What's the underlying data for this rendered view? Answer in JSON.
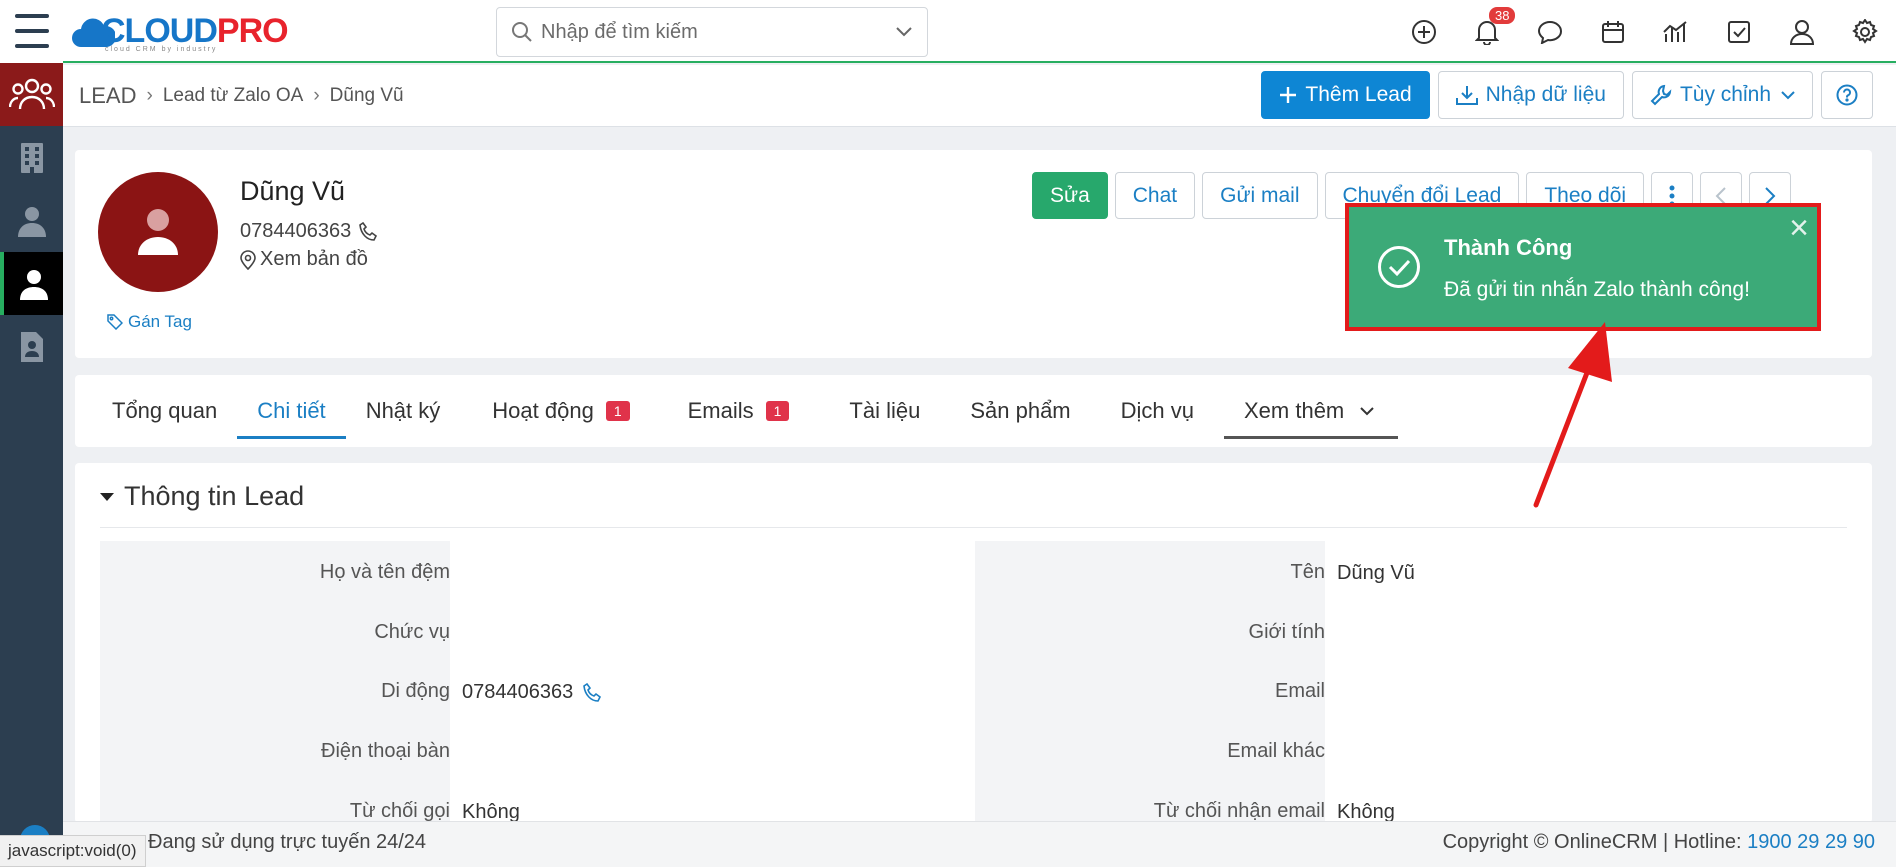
{
  "header": {
    "logo_main": "CLOUD",
    "logo_accent": "PRO",
    "logo_sub": "cloud CRM by industry",
    "search_placeholder": "Nhập để tìm kiếm",
    "notification_count": "38",
    "icons": [
      "plus-circle-icon",
      "bell-icon",
      "chat-icon",
      "calendar-icon",
      "report-icon",
      "task-icon",
      "user-icon",
      "gear-icon"
    ]
  },
  "sidebar": {
    "items": [
      "menu-icon",
      "leads-icon",
      "organization-icon",
      "contact-icon",
      "lead-person-icon",
      "document-icon"
    ]
  },
  "breadcrumb": {
    "root": "LEAD",
    "level1": "Lead từ Zalo OA",
    "level2": "Dũng Vũ"
  },
  "toolbar": {
    "add_lead": "Thêm Lead",
    "import": "Nhập dữ liệu",
    "customize": "Tùy chỉnh"
  },
  "profile": {
    "name": "Dũng Vũ",
    "phone": "0784406363",
    "map": "Xem bản đồ",
    "tag": "Gán Tag",
    "actions": {
      "edit": "Sửa",
      "chat": "Chat",
      "send_mail": "Gửi mail",
      "convert": "Chuyển đổi Lead",
      "follow": "Theo dõi"
    }
  },
  "tabs": [
    {
      "label": "Tổng quan"
    },
    {
      "label": "Chi tiết"
    },
    {
      "label": "Nhật ký"
    },
    {
      "label": "Hoạt động",
      "badge": "1"
    },
    {
      "label": "Emails",
      "badge": "1"
    },
    {
      "label": "Tài liệu"
    },
    {
      "label": "Sản phẩm"
    },
    {
      "label": "Dịch vụ"
    },
    {
      "label": "Xem thêm"
    }
  ],
  "section": {
    "title": "Thông tin Lead",
    "left": [
      {
        "label": "Họ và tên đệm",
        "value": ""
      },
      {
        "label": "Chức vụ",
        "value": ""
      },
      {
        "label": "Di động",
        "value": "0784406363"
      },
      {
        "label": "Điện thoại bàn",
        "value": ""
      },
      {
        "label": "Từ chối gọi",
        "value": "Không"
      }
    ],
    "right": [
      {
        "label": "Tên",
        "value": "Dũng Vũ"
      },
      {
        "label": "Giới tính",
        "value": ""
      },
      {
        "label": "Email",
        "value": ""
      },
      {
        "label": "Email khác",
        "value": ""
      },
      {
        "label": "Từ chối nhận email",
        "value": "Không"
      }
    ]
  },
  "toast": {
    "title": "Thành Công",
    "message": "Đã gửi tin nhắn Zalo thành công!"
  },
  "footer": {
    "left": "Đang sử dụng trực tuyến 24/24",
    "copyright": "Copyright © OnlineCRM | Hotline: ",
    "hotline": "1900 29 29 90",
    "status_url": "javascript:void(0)"
  },
  "colors": {
    "brand_blue": "#0e86d4",
    "success_green": "#27a86c",
    "lead_red": "#8b1a1a",
    "sidebar": "#2c3e50",
    "toast_border": "#e31b1b"
  }
}
